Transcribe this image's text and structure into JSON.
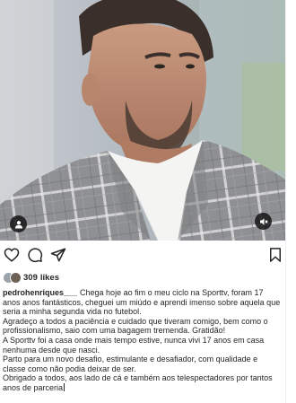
{
  "post": {
    "likes_count": "309",
    "likes_word": "likes",
    "username": "pedrohenriques___",
    "caption_lines": [
      "Chega hoje ao fim o meu ciclo na Sporttv, foram 17 anos anos fantásticos, cheguei um miúdo e aprendi imenso sobre aquela que seria a minha segunda vida no futebol.",
      "Agradeço a todos a paciência e cuidado que tiveram  comigo, bem como o profissionalismo, saio com uma bagagem tremenda. Gratidão!",
      "A Sporttv foi a casa onde mais tempo estive, nunca vivi 17 anos em casa nenhuma desde que nasci.",
      "Parto para um novo desafio, estimulante e desafiador, com qualidade e classe como não podia deixar de ser.",
      "Obrigado a todos, aos  lado de cá e também aos telespectadores por tantos anos de parceria"
    ]
  },
  "icons": {
    "tag": "user-tag-icon",
    "mute": "speaker-muted-icon",
    "like": "heart-icon",
    "comment": "comment-bubble-icon",
    "share": "paper-plane-icon",
    "save": "bookmark-icon"
  },
  "colors": {
    "text": "#262626",
    "background": "#ffffff",
    "overlay_button": "#141414"
  }
}
